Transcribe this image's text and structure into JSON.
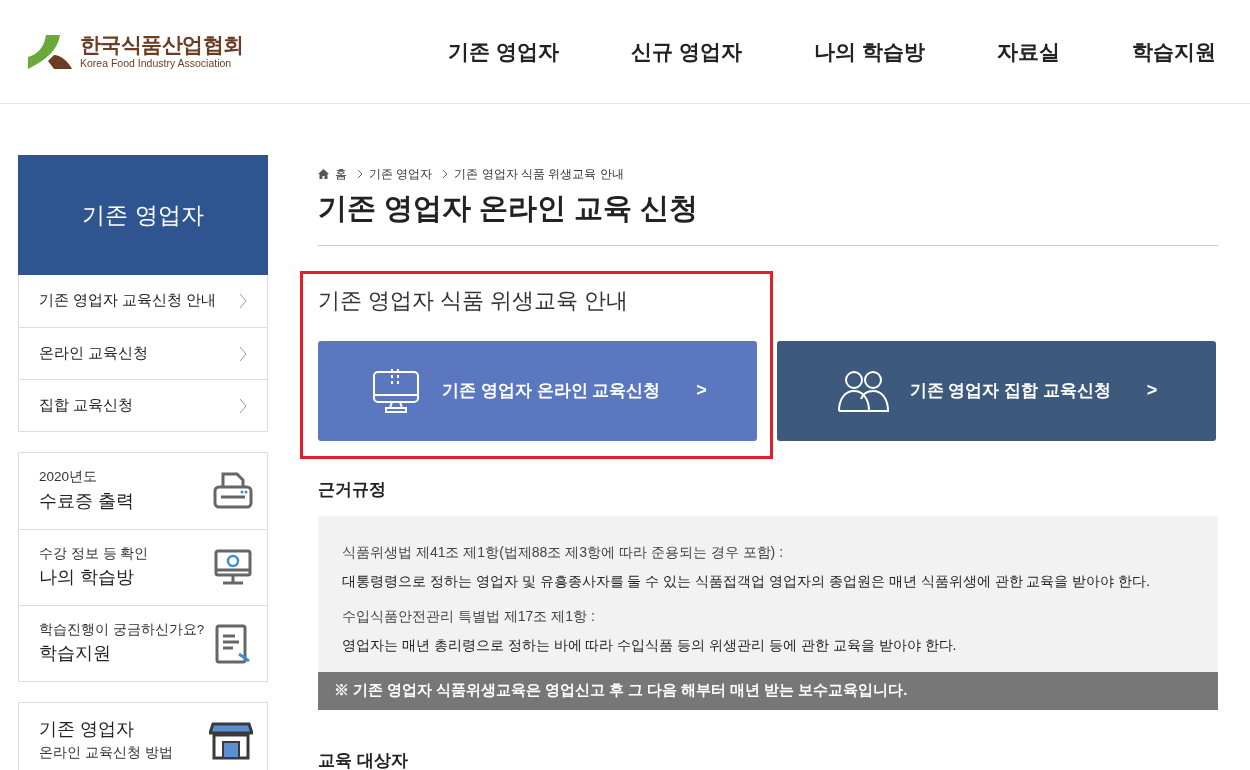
{
  "logo": {
    "name": "한국식품산업협회",
    "subtitle": "Korea Food Industry Association"
  },
  "nav": [
    {
      "label": "기존 영업자",
      "selected": false
    },
    {
      "label": "신규 영업자",
      "selected": false
    },
    {
      "label": "나의 학습방",
      "selected": false
    },
    {
      "label": "자료실",
      "selected": false
    },
    {
      "label": "학습지원",
      "selected": false
    }
  ],
  "sidebar": {
    "title": "기존 영업자",
    "items": [
      {
        "label": "기존 영업자 교육신청 안내"
      },
      {
        "label": "온라인 교육신청"
      },
      {
        "label": "집합 교육신청"
      }
    ],
    "quick_links": [
      {
        "kind": "printer",
        "caption": "2020년도",
        "label": "수료증 출력"
      },
      {
        "kind": "monitor",
        "caption": "수강 정보 등 확인",
        "label": "나의 학습방"
      },
      {
        "kind": "document",
        "caption": "학습진행이 궁금하신가요?",
        "label": "학습지원"
      }
    ],
    "guide": {
      "title": "기존 영업자",
      "caption": "온라인 교육신청 방법"
    }
  },
  "breadcrumb": [
    "홈",
    "기존 영업자",
    "기존 영업자 식품 위생교육 안내"
  ],
  "page_title": "기존 영업자 온라인 교육 신청",
  "section_title": "기존 영업자 식품 위생교육 안내",
  "actions": [
    {
      "kind": "online",
      "label": "기존 영업자 온라인 교육신청",
      "arrow": ">",
      "color": "#5a77bf"
    },
    {
      "kind": "group",
      "label": "기존 영업자 집합 교육신청",
      "arrow": ">",
      "color": "#3d5a7c"
    }
  ],
  "basis": {
    "title": "근거규정",
    "rules": [
      {
        "law": "식품위생법 제41조 제1항(법제88조 제3항에 따라 준용되는 경우 포함) :",
        "text": "대통령령으로 정하는 영업자 및 유흥종사자를 둘 수 있는 식품접객업 영업자의 종업원은 매년 식품위생에 관한 교육을 받아야 한다."
      },
      {
        "law": "수입식품안전관리 특별법 제17조 제1항 :",
        "text": "영업자는 매년 총리령으로 정하는 바에 따라 수입식품 등의 위생관리 등에 관한 교육을 받아야 한다."
      }
    ],
    "note": "※ 기존 영업자 식품위생교육은 영업신고 후 그 다음 해부터 매년 받는 보수교육입니다."
  },
  "target_title": "교육 대상자"
}
